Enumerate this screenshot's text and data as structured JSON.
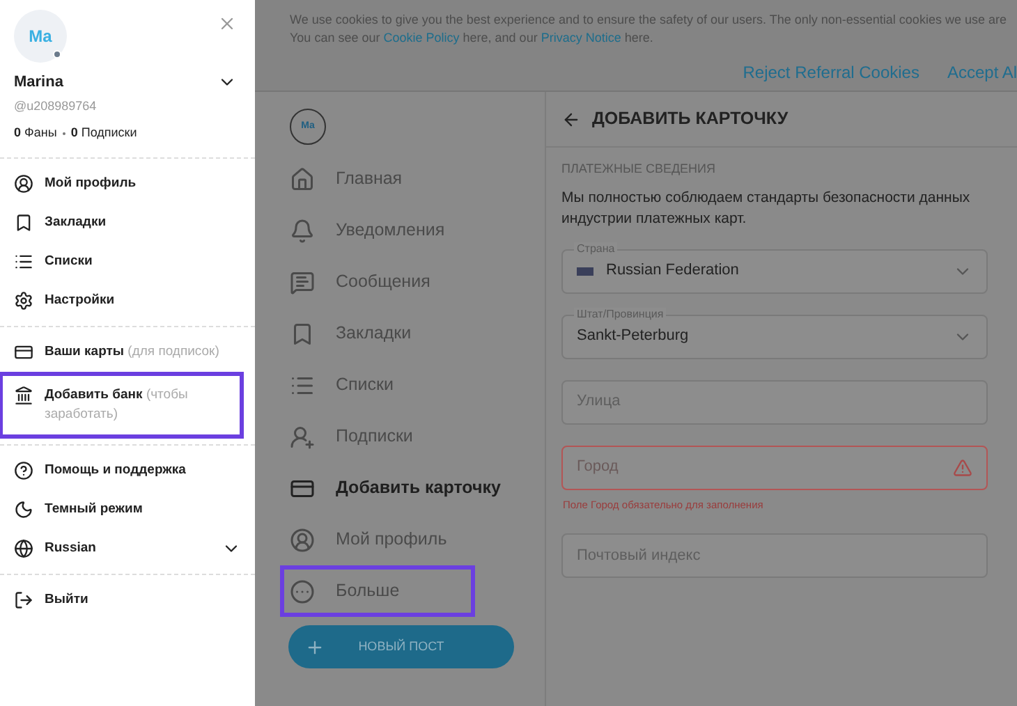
{
  "drawer": {
    "avatar": "Ma",
    "name": "Marina",
    "handle": "@u208989764",
    "expanded": false,
    "stats": [
      {
        "count": "0",
        "label": "Фаны"
      },
      {
        "count": "0",
        "label": "Подписки"
      }
    ],
    "sections": [
      [
        {
          "label": "Мой профиль",
          "highlighted": false
        },
        {
          "label": "Закладки",
          "highlighted": false
        },
        {
          "label": "Списки",
          "highlighted": false
        },
        {
          "label": "Настройки",
          "highlighted": false
        }
      ],
      [
        {
          "label": "Ваши карты",
          "hint": "(для подписок)",
          "highlighted": false
        },
        {
          "label": "Добавить банк",
          "hint": "(чтобы заработать)",
          "highlighted": true
        }
      ],
      [
        {
          "label": "Помощь и поддержка",
          "highlighted": false
        },
        {
          "label": "Темный режим",
          "highlighted": false
        },
        {
          "label": "Russian",
          "kind": "dropdown",
          "highlighted": false
        }
      ],
      [
        {
          "label": "Выйти",
          "highlighted": false
        }
      ]
    ]
  },
  "cookie_banner": {
    "line_1": "We use cookies to give you the best experience and to ensure the safety of our users. The only non-essential cookies we use are",
    "line_2": [
      {
        "kind": "text",
        "text": "You can see our"
      },
      {
        "kind": "link",
        "text": "Cookie Policy"
      },
      {
        "kind": "text",
        "text": "here, and our"
      },
      {
        "kind": "link",
        "text": "Privacy Notice"
      },
      {
        "kind": "text",
        "text": "here."
      }
    ],
    "buttons": [
      "Reject Referral Cookies",
      "Accept Al"
    ]
  },
  "nav": {
    "avatar": "Ma",
    "items": [
      {
        "label": "Главная",
        "selected": false,
        "highlighted": false
      },
      {
        "label": "Уведомления",
        "selected": false,
        "highlighted": false
      },
      {
        "label": "Сообщения",
        "selected": false,
        "highlighted": false
      },
      {
        "label": "Закладки",
        "selected": false,
        "highlighted": false
      },
      {
        "label": "Списки",
        "selected": false,
        "highlighted": false
      },
      {
        "label": "Подписки",
        "selected": false,
        "highlighted": false
      },
      {
        "label": "Добавить карточку",
        "selected": true,
        "highlighted": false
      },
      {
        "label": "Мой профиль",
        "selected": false,
        "highlighted": false
      },
      {
        "label": "Больше",
        "selected": false,
        "highlighted": true
      }
    ],
    "new_post": "НОВЫЙ ПОСТ"
  },
  "page": {
    "title": "ДОБАВИТЬ КАРТОЧКУ",
    "section": "ПЛАТЕЖНЫЕ СВЕДЕНИЯ",
    "description": "Мы полностью соблюдаем стандарты безопасности данных индустрии платежных карт.",
    "fields": [
      {
        "kind": "select",
        "label": "Страна",
        "value": "Russian Federation",
        "flag": true
      },
      {
        "kind": "select",
        "label": "Штат/Провинция",
        "value": "Sankt-Peterburg",
        "flag": false
      },
      {
        "kind": "text",
        "placeholder": "Улица"
      },
      {
        "kind": "text",
        "placeholder": "Город",
        "error": "Поле Город обязательно для заполнения"
      },
      {
        "kind": "text",
        "placeholder": "Почтовый индекс"
      }
    ]
  }
}
